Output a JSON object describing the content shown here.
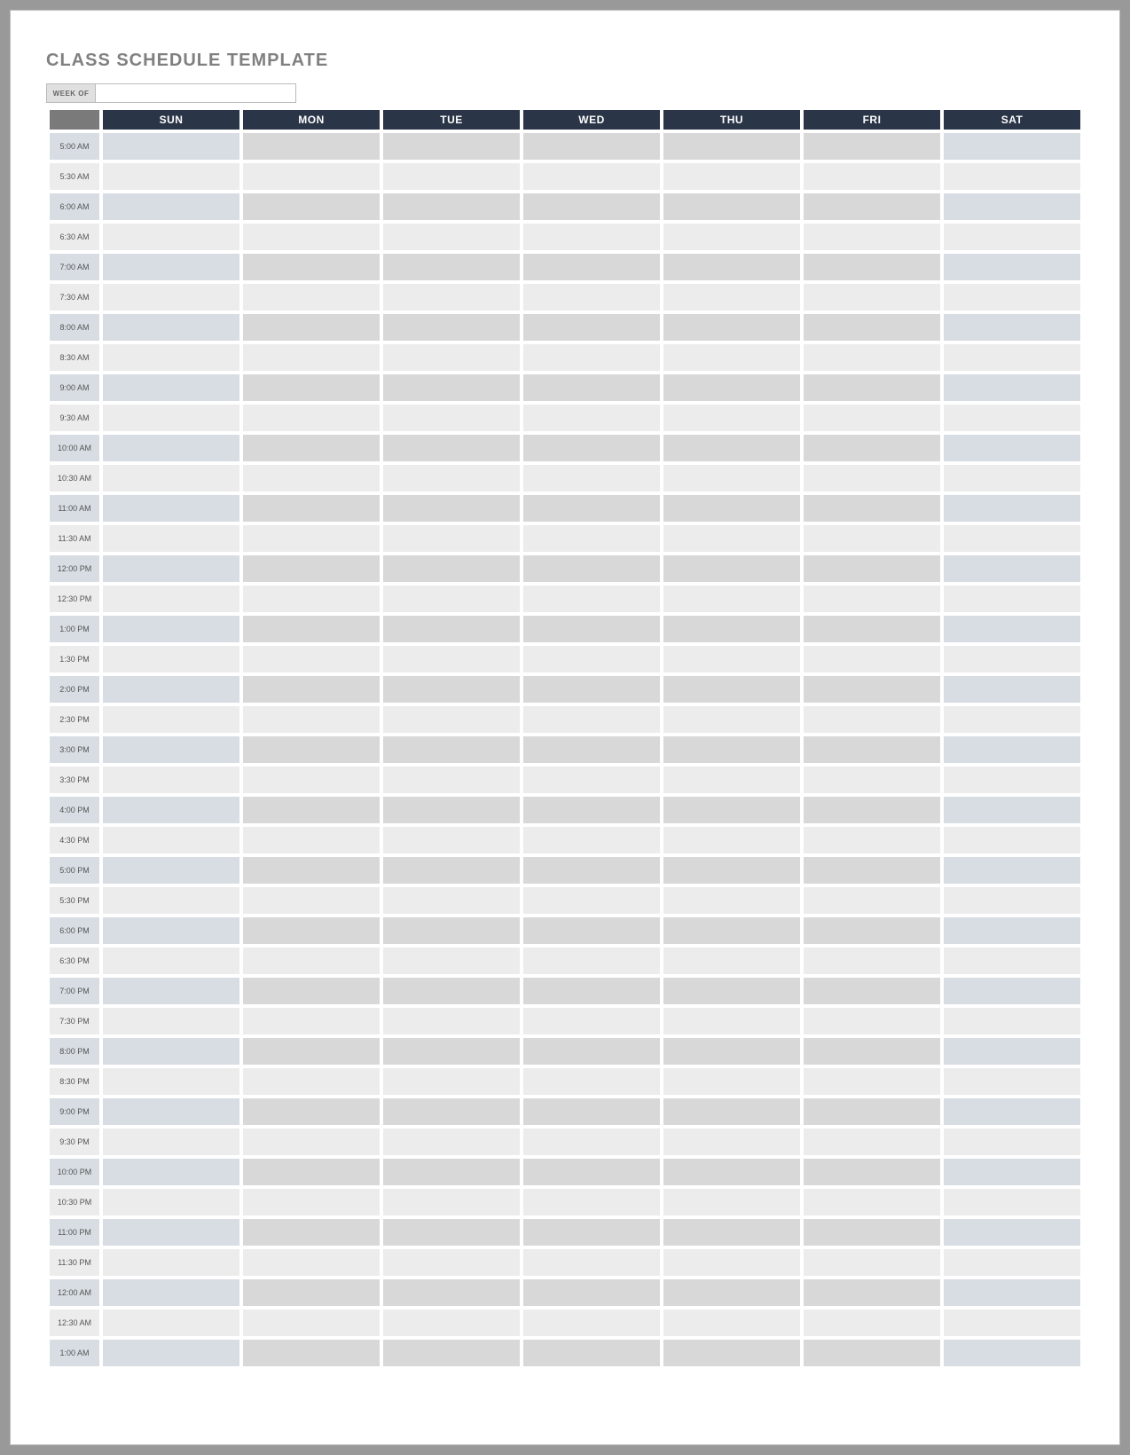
{
  "title": "CLASS SCHEDULE TEMPLATE",
  "weekof": {
    "label": "WEEK OF",
    "value": ""
  },
  "days": [
    "SUN",
    "MON",
    "TUE",
    "WED",
    "THU",
    "FRI",
    "SAT"
  ],
  "times": [
    "5:00 AM",
    "5:30 AM",
    "6:00 AM",
    "6:30 AM",
    "7:00 AM",
    "7:30 AM",
    "8:00 AM",
    "8:30 AM",
    "9:00 AM",
    "9:30 AM",
    "10:00 AM",
    "10:30 AM",
    "11:00 AM",
    "11:30 AM",
    "12:00 PM",
    "12:30 PM",
    "1:00 PM",
    "1:30 PM",
    "2:00 PM",
    "2:30 PM",
    "3:00 PM",
    "3:30 PM",
    "4:00 PM",
    "4:30 PM",
    "5:00 PM",
    "5:30 PM",
    "6:00 PM",
    "6:30 PM",
    "7:00 PM",
    "7:30 PM",
    "8:00 PM",
    "8:30 PM",
    "9:00 PM",
    "9:30 PM",
    "10:00 PM",
    "10:30 PM",
    "11:00 PM",
    "11:30 PM",
    "12:00 AM",
    "12:30 AM",
    "1:00 AM"
  ]
}
